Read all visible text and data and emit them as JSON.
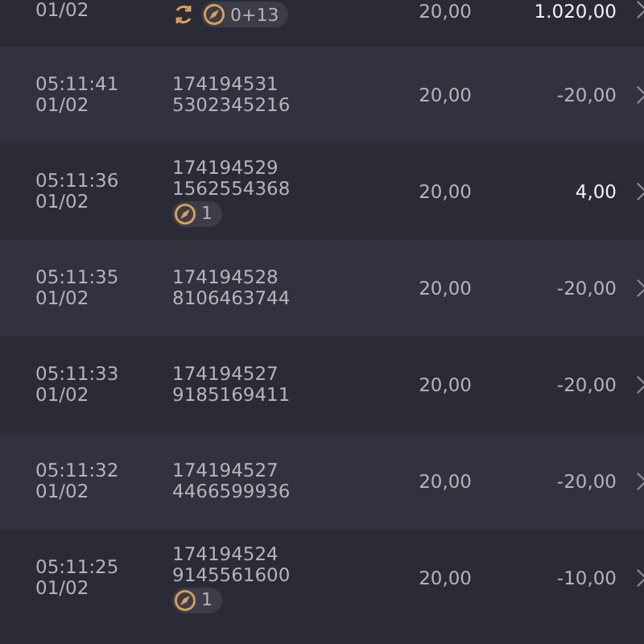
{
  "rows": [
    {
      "time": null,
      "date": "01/02",
      "ids": [],
      "amount": "20,00",
      "result": "1.020,00",
      "positive": true,
      "badges": [
        {
          "kind": "spin"
        },
        {
          "kind": "bonus",
          "count": "0+13"
        }
      ]
    },
    {
      "time": "05:11:41",
      "date": "01/02",
      "ids": [
        "174194531",
        "5302345216"
      ],
      "amount": "20,00",
      "result": "-20,00",
      "positive": false,
      "badges": []
    },
    {
      "time": "05:11:36",
      "date": "01/02",
      "ids": [
        "174194529",
        "1562554368"
      ],
      "amount": "20,00",
      "result": "4,00",
      "positive": true,
      "badges": [
        {
          "kind": "bonus",
          "count": "1"
        }
      ]
    },
    {
      "time": "05:11:35",
      "date": "01/02",
      "ids": [
        "174194528",
        "8106463744"
      ],
      "amount": "20,00",
      "result": "-20,00",
      "positive": false,
      "badges": []
    },
    {
      "time": "05:11:33",
      "date": "01/02",
      "ids": [
        "174194527",
        "9185169411"
      ],
      "amount": "20,00",
      "result": "-20,00",
      "positive": false,
      "badges": []
    },
    {
      "time": "05:11:32",
      "date": "01/02",
      "ids": [
        "174194527",
        "4466599936"
      ],
      "amount": "20,00",
      "result": "-20,00",
      "positive": false,
      "badges": []
    },
    {
      "time": "05:11:25",
      "date": "01/02",
      "ids": [
        "174194524",
        "9145561600"
      ],
      "amount": "20,00",
      "result": "-10,00",
      "positive": false,
      "badges": [
        {
          "kind": "bonus",
          "count": "1"
        }
      ]
    }
  ]
}
